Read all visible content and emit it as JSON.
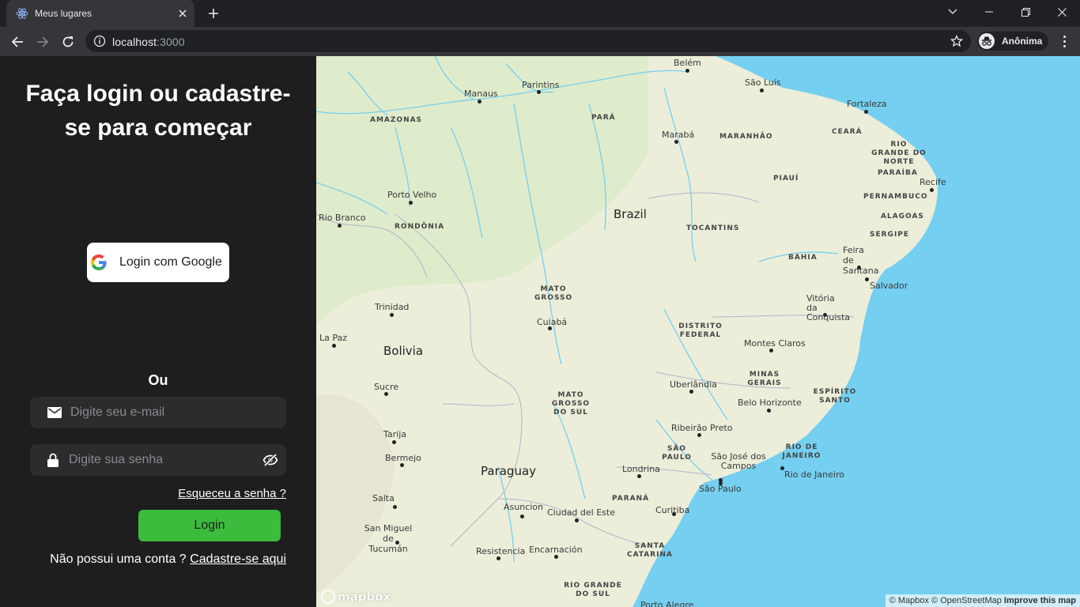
{
  "browser": {
    "tab_title": "Meus lugares",
    "url_host": "localhost",
    "url_port": ":3000",
    "profile_label": "Anônima"
  },
  "login": {
    "heading": "Faça login ou cadastre-se para começar",
    "google_button": "Login com Google",
    "or_label": "Ou",
    "email_placeholder": "Digite seu e-mail",
    "password_placeholder": "Digite sua senha",
    "forgot_password": "Esqueceu a senha ?",
    "login_button": "Login",
    "no_account_text": "Não possui uma conta ?",
    "signup_link": "Cadastre-se aqui"
  },
  "map": {
    "countries": [
      "Brazil",
      "Bolivia",
      "Paraguay"
    ],
    "states": [
      "AMAZONAS",
      "PARÁ",
      "MARANHÃO",
      "CEARÁ",
      "RIO GRANDE DO NORTE",
      "PARAÍBA",
      "PIAUÍ",
      "PERNAMBUCO",
      "ALAGOAS",
      "SERGIPE",
      "RONDÔNIA",
      "TOCANTINS",
      "BAHIA",
      "MATO GROSSO",
      "DISTRITO FEDERAL",
      "MINAS GERAIS",
      "MATO GROSSO DO SUL",
      "ESPÍRITO SANTO",
      "SÃO PAULO",
      "RIO DE JANEIRO",
      "PARANÁ",
      "SANTA CATARINA",
      "RIO GRANDE DO SUL"
    ],
    "cities": [
      "Belém",
      "São Luís",
      "Manaus",
      "Parintins",
      "Fortaleza",
      "Marabá",
      "Recife",
      "Porto Velho",
      "Rio Branco",
      "Feira de Santana",
      "Salvador",
      "Vitória da Conquista",
      "Trinidad",
      "Cuiabá",
      "La Paz",
      "Montes Claros",
      "Uberlândia",
      "Belo Horizonte",
      "Sucre",
      "Tarija",
      "Ribeirão Preto",
      "Bermejo",
      "São José dos Campos",
      "Londrina",
      "Rio de Janeiro",
      "São Paulo",
      "Salta",
      "Asuncion",
      "Ciudad del Este",
      "Curitiba",
      "San Miguel de Tucumán",
      "Resistencia",
      "Encarnación",
      "Porto Alegre"
    ],
    "logo_text": "mapbox",
    "attribution_mapbox": "© Mapbox",
    "attribution_osm": "© OpenStreetMap",
    "attribution_improve": "Improve this map",
    "colors": {
      "water": "#75cff0",
      "land": "#eceeda",
      "green": "#e0ecc8",
      "river": "#6ec9ee"
    }
  }
}
